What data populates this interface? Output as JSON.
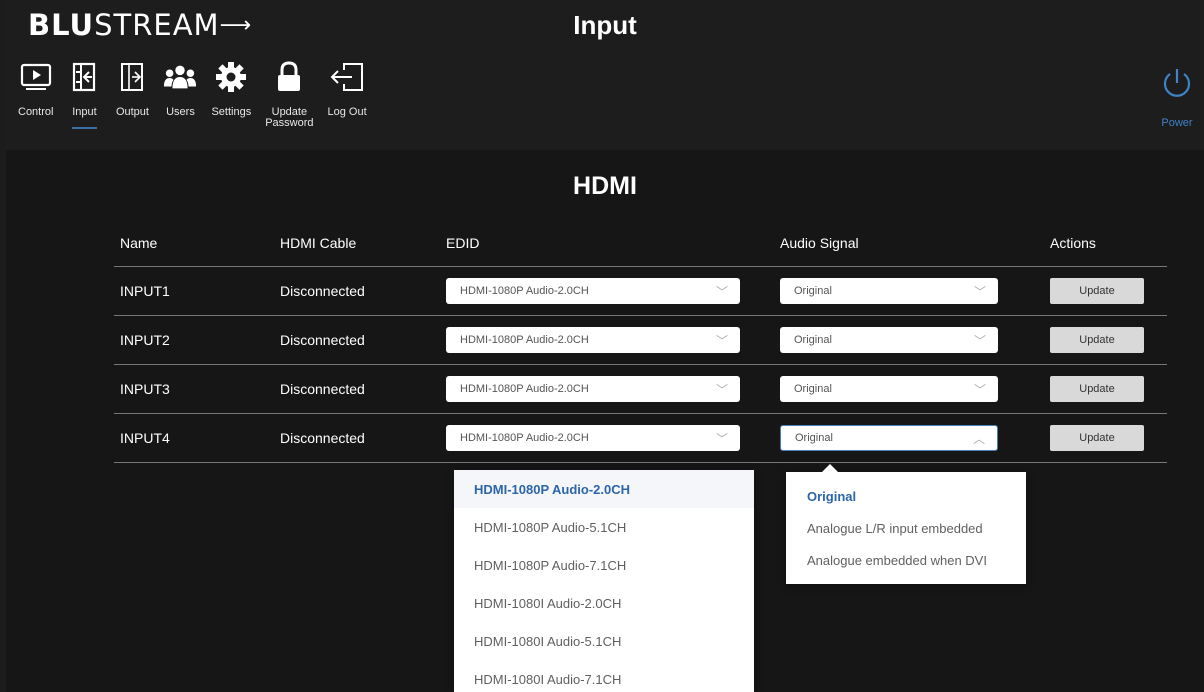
{
  "header": {
    "logo_bold": "BLU",
    "logo_rest": "STREAM",
    "title": "Input"
  },
  "nav": [
    {
      "label": "Control",
      "icon": "play-monitor-icon"
    },
    {
      "label": "Input",
      "icon": "input-icon",
      "active": true
    },
    {
      "label": "Output",
      "icon": "output-icon"
    },
    {
      "label": "Users",
      "icon": "users-icon"
    },
    {
      "label": "Settings",
      "icon": "gear-icon"
    },
    {
      "label": "Update\nPassword",
      "icon": "lock-icon"
    },
    {
      "label": "Log Out",
      "icon": "logout-icon"
    }
  ],
  "power": {
    "label": "Power",
    "icon": "power-icon",
    "color": "#3f82c6"
  },
  "section_title": "HDMI",
  "table": {
    "headers": [
      "Name",
      "HDMI Cable",
      "EDID",
      "Audio Signal",
      "Actions"
    ],
    "rows": [
      {
        "name": "INPUT1",
        "cable": "Disconnected",
        "edid": "HDMI-1080P Audio-2.0CH",
        "audio": "Original",
        "action": "Update"
      },
      {
        "name": "INPUT2",
        "cable": "Disconnected",
        "edid": "HDMI-1080P Audio-2.0CH",
        "audio": "Original",
        "action": "Update"
      },
      {
        "name": "INPUT3",
        "cable": "Disconnected",
        "edid": "HDMI-1080P Audio-2.0CH",
        "audio": "Original",
        "action": "Update"
      },
      {
        "name": "INPUT4",
        "cable": "Disconnected",
        "edid": "HDMI-1080P Audio-2.0CH",
        "audio": "Original",
        "action": "Update"
      }
    ]
  },
  "edid_dropdown": {
    "options": [
      "HDMI-1080P Audio-2.0CH",
      "HDMI-1080P Audio-5.1CH",
      "HDMI-1080P Audio-7.1CH",
      "HDMI-1080I Audio-2.0CH",
      "HDMI-1080I Audio-5.1CH",
      "HDMI-1080I Audio-7.1CH"
    ],
    "selected": "HDMI-1080P Audio-2.0CH"
  },
  "audio_dropdown": {
    "options": [
      "Original",
      "Analogue L/R input embedded",
      "Analogue embedded when DVI"
    ],
    "selected": "Original"
  },
  "colors": {
    "accent": "#3f82c6",
    "selected_option": "#2c65a8",
    "background": "#161616"
  }
}
